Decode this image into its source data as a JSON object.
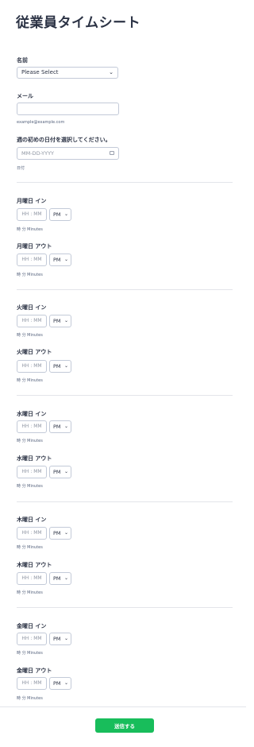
{
  "form": {
    "title": "従業員タイムシート",
    "name": {
      "label": "名前",
      "placeholder": "Please Select"
    },
    "email": {
      "label": "メール",
      "sublabel": "example@example.com"
    },
    "week_start": {
      "label": "週の初めの日付を選択してください。",
      "placeholder": "MM-DD-YYYY",
      "sublabel": "日付"
    },
    "days": [
      {
        "in_label": "月曜日 イン",
        "out_label": "月曜日 アウト"
      },
      {
        "in_label": "火曜日 イン",
        "out_label": "火曜日 アウト"
      },
      {
        "in_label": "水曜日 イン",
        "out_label": "水曜日 アウト"
      },
      {
        "in_label": "木曜日 イン",
        "out_label": "木曜日 アウト"
      },
      {
        "in_label": "金曜日 イン",
        "out_label": "金曜日 アウト"
      }
    ],
    "time_placeholder": "HH : MM",
    "ampm_value": "PM",
    "time_sublabel": "時 分 Minutes",
    "submit_label": "送信する"
  }
}
